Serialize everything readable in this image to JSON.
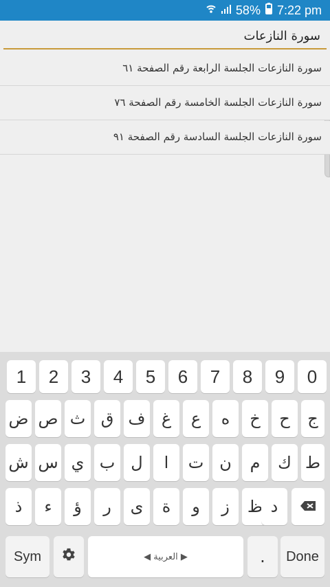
{
  "status": {
    "battery_percent": "58%",
    "time": "7:22 pm"
  },
  "search": {
    "value": "سورة النازعات"
  },
  "results": [
    {
      "text": "سورة النازعات الجلسة الرابعة رقم الصفحة ٦١"
    },
    {
      "text": "سورة النازعات الجلسة الخامسة رقم الصفحة ٧٦"
    },
    {
      "text": "سورة النازعات الجلسة السادسة رقم الصفحة ٩١"
    }
  ],
  "keyboard": {
    "row1": [
      "1",
      "2",
      "3",
      "4",
      "5",
      "6",
      "7",
      "8",
      "9",
      "0"
    ],
    "row2": [
      "ض",
      "ص",
      "ث",
      "ق",
      "ف",
      "غ",
      "ع",
      "ه",
      "خ",
      "ح",
      "ج"
    ],
    "row3": [
      "ش",
      "س",
      "ي",
      "ب",
      "ل",
      "ا",
      "ت",
      "ن",
      "م",
      "ك",
      "ط"
    ],
    "row4": [
      "ذ",
      "ء",
      "ؤ",
      "ر",
      "ى",
      "ة",
      "و",
      "ز",
      "ظ",
      "د"
    ],
    "sym_label": "Sym",
    "lang_label": "العربية",
    "done_label": "Done",
    "period": "."
  }
}
